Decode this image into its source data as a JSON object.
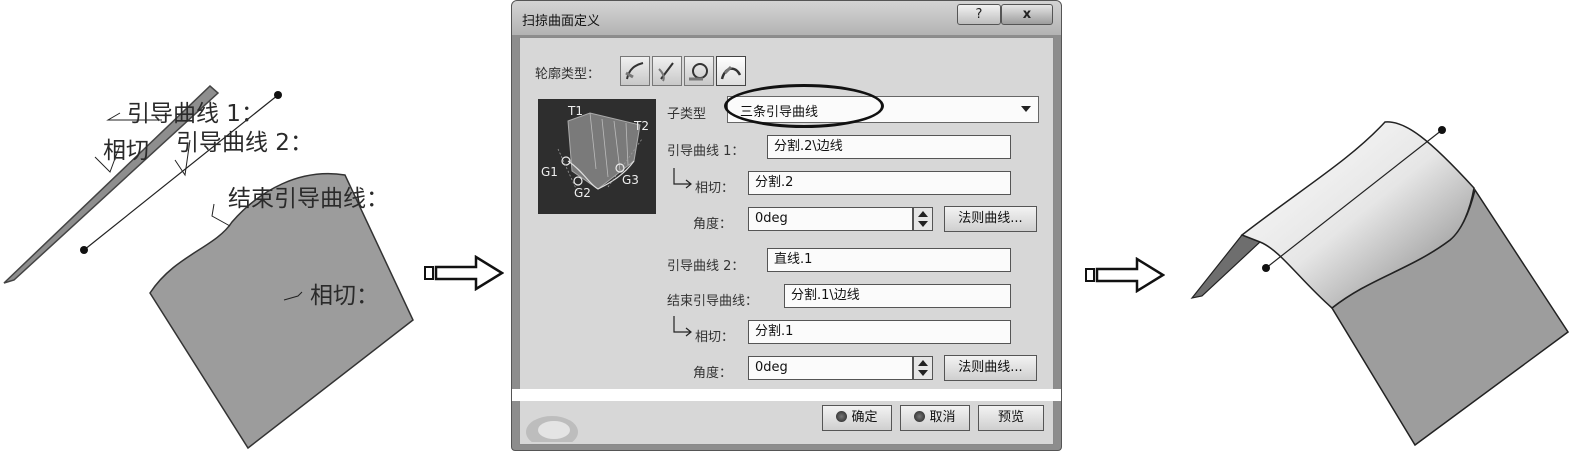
{
  "left_figure": {
    "annotations": {
      "guide_curve_1": "引导曲线 1：",
      "tangent_top": "相切",
      "guide_curve_2": "引导曲线 2：",
      "end_guide_curve": "结束引导曲线：",
      "tangent_bottom": "相切："
    }
  },
  "dialog": {
    "title": "扫掠曲面定义",
    "help_label": "?",
    "close_label": "x",
    "profile_type_label": "轮廓类型：",
    "profile_type_icons": [
      "explicit-profile-icon",
      "line-profile-icon",
      "circle-profile-icon",
      "conic-profile-icon"
    ],
    "preview_labels": {
      "t1": "T1",
      "t2": "T2",
      "g1": "G1",
      "g2": "G2",
      "g3": "G3"
    },
    "subtype_label": "子类型",
    "subtype_value": "三条引导曲线",
    "guide1_label": "引导曲线 1：",
    "guide1_value": "分割.2\\边线",
    "tangent1_label": "相切：",
    "tangent1_value": "分割.2",
    "angle1_label": "角度：",
    "angle1_value": "0deg",
    "law_curve1_label": "法则曲线...",
    "guide2_label": "引导曲线 2：",
    "guide2_value": "直线.1",
    "end_guide_label": "结束引导曲线：",
    "end_guide_value": "分割.1\\边线",
    "tangent2_label": "相切：",
    "tangent2_value": "分割.1",
    "angle2_label": "角度：",
    "angle2_value": "0deg",
    "law_curve2_label": "法则曲线...",
    "ok_label": "确定",
    "cancel_label": "取消",
    "preview_label": "预览"
  }
}
